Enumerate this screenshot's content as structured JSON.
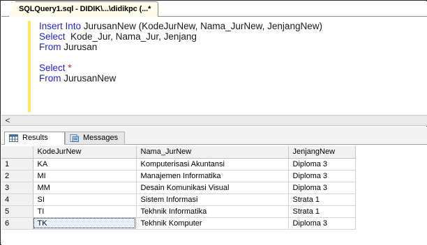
{
  "window": {
    "tab_title": "SQLQuery1.sql - DIDIK\\...\\didikpc (...*"
  },
  "editor": {
    "lines": [
      [
        {
          "t": "Insert Into ",
          "c": "kw"
        },
        {
          "t": "JurusanNew ",
          "c": "tx"
        },
        {
          "t": "(KodeJurNew, Nama_JurNew, JenjangNew)",
          "c": "tx"
        }
      ],
      [
        {
          "t": "Select ",
          "c": "kw"
        },
        {
          "t": " Kode_Jur, Nama_Jur, Jenjang",
          "c": "tx"
        }
      ],
      [
        {
          "t": "From ",
          "c": "kw"
        },
        {
          "t": "Jurusan",
          "c": "tx"
        }
      ],
      [],
      [
        {
          "t": "Select ",
          "c": "kw"
        },
        {
          "t": "*",
          "c": "rd"
        }
      ],
      [
        {
          "t": "From ",
          "c": "kw"
        },
        {
          "t": "JurusanNew",
          "c": "tx"
        }
      ]
    ]
  },
  "scroll": {
    "left_arrow": "<"
  },
  "results": {
    "tabs": {
      "results_label": "Results",
      "messages_label": "Messages"
    },
    "columns": [
      "KodeJurNew",
      "Nama_JurNew",
      "JenjangNew"
    ],
    "rows": [
      {
        "n": "1",
        "cells": [
          "KA",
          "Komputerisasi Akuntansi",
          "Diploma 3"
        ]
      },
      {
        "n": "2",
        "cells": [
          "MI",
          "Manajemen Informatika",
          "Diploma 3"
        ]
      },
      {
        "n": "3",
        "cells": [
          "MM",
          "Desain Komunikasi Visual",
          "Diploma 3"
        ]
      },
      {
        "n": "4",
        "cells": [
          "SI",
          "Sistem Informasi",
          "Strata 1"
        ]
      },
      {
        "n": "5",
        "cells": [
          "TI",
          "Tekhnik Informatika",
          "Strata 1"
        ]
      },
      {
        "n": "6",
        "cells": [
          "TK",
          "Tekhnik Komputer",
          "Diploma 3"
        ]
      }
    ],
    "selected": {
      "row": 5,
      "col": 0
    }
  },
  "colors": {
    "keyword": "#1f1fd8",
    "change_marker": "#ffe65a",
    "star": "#e01818"
  }
}
